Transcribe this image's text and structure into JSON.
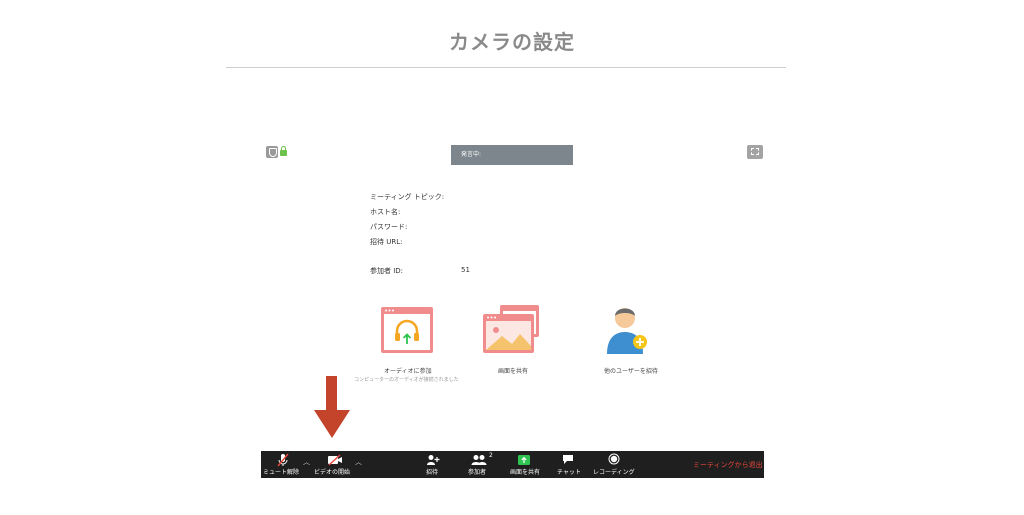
{
  "page": {
    "title": "カメラの設定"
  },
  "meeting": {
    "speaking_label": "発言中:",
    "info_labels": [
      "ミーティング トピック:",
      "ホスト名:",
      "パスワード:",
      "招待 URL:"
    ],
    "participant_id_label": "参加者 ID:",
    "participant_id_value": "51"
  },
  "actions": {
    "join_audio": {
      "label": "オーディオに参加",
      "sub": "コンピューターのオーディオが接続されました"
    },
    "share_screen": {
      "label": "画面を共有"
    },
    "invite_others": {
      "label": "他のユーザーを招待"
    }
  },
  "toolbar": {
    "unmute": "ミュート解除",
    "start_video": "ビデオの開始",
    "invite": "招待",
    "participants": "参加者",
    "participants_count": "2",
    "share_screen": "画面を共有",
    "chat": "チャット",
    "recording": "レコーディング",
    "leave": "ミーティングから退出"
  },
  "colors": {
    "toolbar_bg": "#1f1f1f",
    "leave_red": "#e8483a",
    "arrow": "#c4432b",
    "share_green": "#2ec44f",
    "card_pink": "#f08c8c"
  }
}
